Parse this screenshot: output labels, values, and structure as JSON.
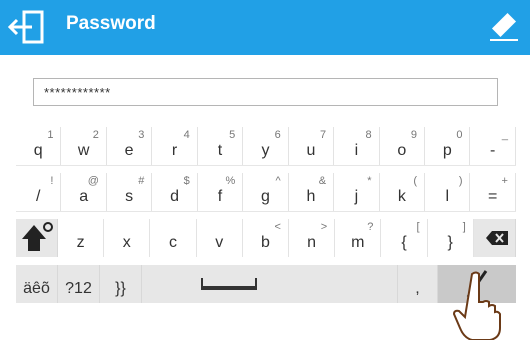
{
  "header": {
    "title": "Password",
    "back_icon": "back-arrow-icon",
    "clear_icon": "eraser-icon",
    "accent": "#21a0e6"
  },
  "input": {
    "value": "************"
  },
  "keyboard": {
    "row1": [
      {
        "k": "q",
        "s": "1"
      },
      {
        "k": "w",
        "s": "2"
      },
      {
        "k": "e",
        "s": "3"
      },
      {
        "k": "r",
        "s": "4"
      },
      {
        "k": "t",
        "s": "5"
      },
      {
        "k": "y",
        "s": "6"
      },
      {
        "k": "u",
        "s": "7"
      },
      {
        "k": "i",
        "s": "8"
      },
      {
        "k": "o",
        "s": "9"
      },
      {
        "k": "p",
        "s": "0"
      },
      {
        "k": "-",
        "s": "_"
      }
    ],
    "row2": [
      {
        "k": "/",
        "s": "!"
      },
      {
        "k": "a",
        "s": "@"
      },
      {
        "k": "s",
        "s": "#"
      },
      {
        "k": "d",
        "s": "$"
      },
      {
        "k": "f",
        "s": "%"
      },
      {
        "k": "g",
        "s": "^"
      },
      {
        "k": "h",
        "s": "&"
      },
      {
        "k": "j",
        "s": "*"
      },
      {
        "k": "k",
        "s": "("
      },
      {
        "k": "l",
        "s": ")"
      },
      {
        "k": "=",
        "s": "+"
      }
    ],
    "row3": [
      {
        "k": "z",
        "s": ""
      },
      {
        "k": "x",
        "s": ""
      },
      {
        "k": "c",
        "s": ""
      },
      {
        "k": "v",
        "s": ""
      },
      {
        "k": "b",
        "s": "<"
      },
      {
        "k": "n",
        "s": ">"
      },
      {
        "k": "m",
        "s": "?"
      },
      {
        "k": "{",
        "s": "["
      },
      {
        "k": "}",
        "s": "]"
      }
    ],
    "row4": {
      "accents_label": "äêõ",
      "num_label": "?12",
      "braces_label": "}}",
      "comma_label": ","
    },
    "shift_icon": "shift-arrow-icon",
    "backspace_icon": "backspace-icon",
    "ok_icon": "checkmark-icon"
  }
}
